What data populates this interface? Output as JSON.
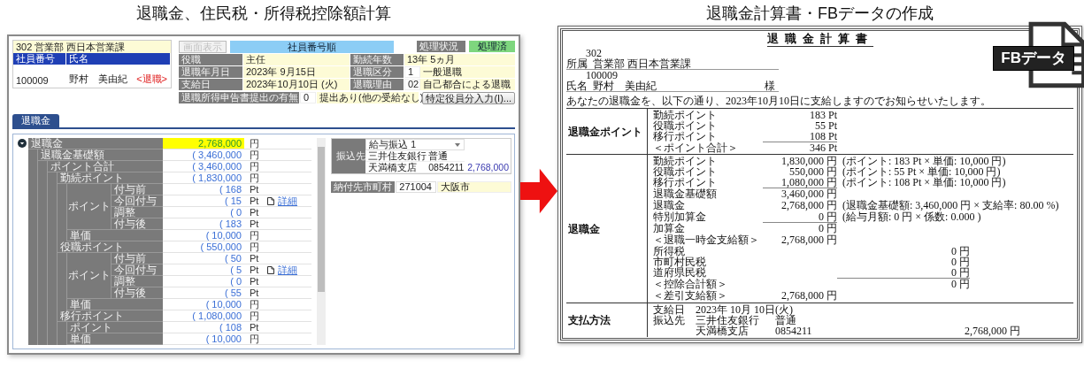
{
  "screen": {
    "title": "退職金、住民税・所得税控除額計算",
    "employee": {
      "department": "302 営業部 西日本営業課",
      "columns": [
        "社員番号",
        "氏名"
      ],
      "number": "100009",
      "name": "野村　美由紀",
      "status": "<退職>"
    },
    "view_button": {
      "label": "画面表示",
      "disabled": true
    },
    "sort_bar": "社員番号順",
    "process": {
      "label": "処理状況",
      "value": "処理済"
    },
    "info": [
      {
        "label": "役職",
        "value": "主任"
      },
      {
        "label": "勤続年数",
        "value": "13年 5ヵ月"
      },
      {
        "label": "退職年月日",
        "value": "2023年 9月15日"
      },
      {
        "label": "退職区分",
        "code": "1",
        "value": "一般退職"
      },
      {
        "label": "支給日",
        "value": "2023年10月10日 (火)"
      },
      {
        "label": "退職理由",
        "code": "02",
        "value": "自己都合による退職"
      }
    ],
    "declaration": {
      "label": "退職所得申告書提出の有無",
      "code": "0",
      "value": "提出あり(他の受給なし)"
    },
    "officer_button": "特定役員分入力(I)...",
    "tabs": [
      {
        "label": "退職金",
        "selected": true
      }
    ],
    "tree": {
      "kind": "node",
      "label": "退職金",
      "value": "2,768,000",
      "unit": "円",
      "highlighted": true,
      "expanded": true,
      "children": [
        {
          "kind": "node",
          "label": "退職金基礎額",
          "value": "( 3,460,000",
          "unit": "円",
          "highlighted": false,
          "children": [
            {
              "kind": "node",
              "label": "ポイント合計",
              "value": "( 3,460,000",
              "unit": "円",
              "highlighted": false,
              "children": [
                {
                  "kind": "node",
                  "label": "勤続ポイント",
                  "value": "( 1,830,000",
                  "unit": "円",
                  "highlighted": false,
                  "children": [
                    {
                      "kind": "side",
                      "label": "ポイント",
                      "children": [
                        {
                          "kind": "node",
                          "label": "付与前",
                          "value": "( 168",
                          "unit": "Pt",
                          "highlighted": false
                        },
                        {
                          "kind": "node",
                          "label": "今回付与",
                          "value": "( 15",
                          "unit": "Pt",
                          "highlighted": false,
                          "detail": "詳細"
                        },
                        {
                          "kind": "node",
                          "label": "調整",
                          "value": "( 0",
                          "unit": "Pt",
                          "highlighted": false
                        },
                        {
                          "kind": "node",
                          "label": "付与後",
                          "value": "( 183",
                          "unit": "Pt",
                          "highlighted": false
                        }
                      ]
                    },
                    {
                      "kind": "node",
                      "label": "単価",
                      "value": "( 10,000",
                      "unit": "円",
                      "highlighted": false
                    }
                  ]
                },
                {
                  "kind": "node",
                  "label": "役職ポイント",
                  "value": "( 550,000",
                  "unit": "円",
                  "highlighted": false,
                  "children": [
                    {
                      "kind": "side",
                      "label": "ポイント",
                      "children": [
                        {
                          "kind": "node",
                          "label": "付与前",
                          "value": "( 50",
                          "unit": "Pt",
                          "highlighted": false
                        },
                        {
                          "kind": "node",
                          "label": "今回付与",
                          "value": "( 5",
                          "unit": "Pt",
                          "highlighted": false,
                          "detail": "詳細"
                        },
                        {
                          "kind": "node",
                          "label": "調整",
                          "value": "( 0",
                          "unit": "Pt",
                          "highlighted": false
                        },
                        {
                          "kind": "node",
                          "label": "付与後",
                          "value": "( 55",
                          "unit": "Pt",
                          "highlighted": false
                        }
                      ]
                    },
                    {
                      "kind": "node",
                      "label": "単価",
                      "value": "( 10,000",
                      "unit": "円",
                      "highlighted": false
                    }
                  ]
                },
                {
                  "kind": "node",
                  "label": "移行ポイント",
                  "value": "( 1,080,000",
                  "unit": "円",
                  "highlighted": false,
                  "children": [
                    {
                      "kind": "node",
                      "label": "ポイント",
                      "value": "( 108",
                      "unit": "Pt",
                      "highlighted": false
                    },
                    {
                      "kind": "node",
                      "label": "単価",
                      "value": "( 10,000",
                      "unit": "円",
                      "highlighted": false
                    }
                  ]
                }
              ]
            }
          ]
        }
      ]
    },
    "bank": {
      "label": "振込先",
      "select": "給与振込 1",
      "rows": [
        [
          "三井住友銀行",
          "普通"
        ],
        [
          "天満橋支店",
          "0854211",
          "2,768,000"
        ]
      ]
    },
    "municipality": {
      "label": "納付先市町村",
      "code": "271004",
      "name": "大阪市"
    }
  },
  "document": {
    "heading": "退職金計算書・FBデータの作成",
    "title": "退職金計算書",
    "dept_code": "302",
    "dept_label": "所属",
    "dept": "営業部 西日本営業課",
    "emp_no": "100009",
    "name_label": "氏名",
    "name": "野村　美由紀",
    "honorific": "様",
    "notice": "あなたの退職金を、以下の通り、2023年10月10日に支給しますのでお知らせいたします。",
    "points": {
      "label": "退職金ポイント",
      "lines": [
        {
          "item": "勤続ポイント",
          "amount": "183 Pt",
          "underlined": false
        },
        {
          "item": "役職ポイント",
          "amount": "55 Pt",
          "underlined": false
        },
        {
          "item": "移行ポイント",
          "amount": "108 Pt",
          "underlined": true
        },
        {
          "item": "＜ポイント合計＞",
          "amount": "346 Pt",
          "underlined": false
        }
      ]
    },
    "payout": {
      "label": "退職金",
      "groups": [
        [
          {
            "kind": "amount",
            "item": "勤続ポイント",
            "amount": "1,830,000 円",
            "note": "(ポイント: 183 Pt × 単価: 10,000 円)",
            "underlined": false
          },
          {
            "kind": "amount",
            "item": "役職ポイント",
            "amount": "550,000 円",
            "note": "(ポイント: 55 Pt × 単価: 10,000 円)",
            "underlined": false
          },
          {
            "kind": "amount",
            "item": "移行ポイント",
            "amount": "1,080,000 円",
            "note": "(ポイント: 108 Pt × 単価: 10,000 円)",
            "underlined": true
          },
          {
            "kind": "amount",
            "item": "退職金基礎額",
            "amount": "3,460,000 円",
            "underlined": false
          }
        ],
        [
          {
            "kind": "amount",
            "item": "退職金",
            "amount": "2,768,000 円",
            "note": "(退職金基礎額: 3,460,000 円 × 支給率: 80.00 %)",
            "underlined": false
          }
        ],
        [
          {
            "kind": "amount",
            "item": "特別加算金",
            "amount": "0 円",
            "note": "(給与月額: 0 円 × 係数: 0.000 )",
            "underlined": true
          },
          {
            "kind": "amount",
            "item": "加算金",
            "amount": "0 円",
            "underlined": false
          }
        ],
        [
          {
            "kind": "amount",
            "item": "＜退職一時金支給額＞",
            "amount": "2,768,000 円",
            "underlined": false
          }
        ],
        [
          {
            "kind": "deduction",
            "item": "所得税",
            "amount": "0 円",
            "underlined": false
          },
          {
            "kind": "deduction",
            "item": "市町村民税",
            "amount": "0 円",
            "underlined": false
          },
          {
            "kind": "deduction",
            "item": "道府県民税",
            "amount": "0 円",
            "underlined": true
          },
          {
            "kind": "deduction",
            "item": "＜控除合計額＞",
            "amount": "0 円",
            "underlined": false
          }
        ],
        [
          {
            "kind": "amount",
            "item": "＜差引支給額＞",
            "amount": "2,768,000 円",
            "underlined": false
          }
        ]
      ]
    },
    "payment": {
      "label": "支払方法",
      "rows": [
        {
          "label": "支給日",
          "cells": [
            "2023年 10月 10日(火)"
          ]
        },
        {
          "label": "振込先",
          "cells": [
            "三井住友銀行",
            "普通"
          ]
        },
        {
          "cells": [
            "天満橋支店",
            "0854211",
            "2,768,000 円"
          ]
        }
      ]
    },
    "fb_label": "FBデータ"
  }
}
